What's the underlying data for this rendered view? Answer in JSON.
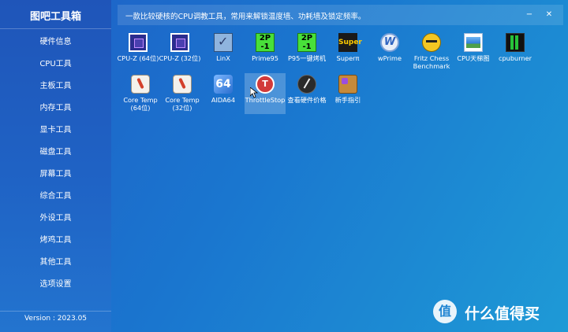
{
  "app": {
    "title": "图吧工具箱",
    "version": "Version : 2023.05"
  },
  "sidebar": {
    "items": [
      {
        "label": "硬件信息"
      },
      {
        "label": "CPU工具"
      },
      {
        "label": "主板工具"
      },
      {
        "label": "内存工具"
      },
      {
        "label": "显卡工具"
      },
      {
        "label": "磁盘工具"
      },
      {
        "label": "屏幕工具"
      },
      {
        "label": "综合工具"
      },
      {
        "label": "外设工具"
      },
      {
        "label": "烤鸡工具"
      },
      {
        "label": "其他工具"
      },
      {
        "label": "选项设置"
      }
    ]
  },
  "notice": {
    "text": "一款比较硬核的CPU调教工具，常用来解锁温度墙、功耗墙及锁定频率。",
    "minimize_icon": "−",
    "close_icon": "✕"
  },
  "tools": [
    {
      "label": "CPU-Z (64位)",
      "icon": "cpuz",
      "text": ""
    },
    {
      "label": "CPU-Z (32位)",
      "icon": "cpuz",
      "text": ""
    },
    {
      "label": "LinX",
      "icon": "linx",
      "text": ""
    },
    {
      "label": "Prime95",
      "icon": "prime",
      "text": "2P\n-1"
    },
    {
      "label": "P95一键烤机",
      "icon": "prime",
      "text": "2P\n-1"
    },
    {
      "label": "Superπ",
      "icon": "superpi",
      "text": "Super"
    },
    {
      "label": "wPrime",
      "icon": "wprime",
      "text": "W"
    },
    {
      "label": "Fritz Chess\nBenchmark",
      "icon": "fritz",
      "text": ""
    },
    {
      "label": "CPU天梯图",
      "icon": "cpusky",
      "text": ""
    },
    {
      "label": "cpuburner",
      "icon": "cpuburner",
      "text": ""
    },
    {
      "label": "Core Temp\n(64位)",
      "icon": "coretemp",
      "text": ""
    },
    {
      "label": "Core Temp\n(32位)",
      "icon": "coretemp",
      "text": ""
    },
    {
      "label": "AIDA64",
      "icon": "aida",
      "text": "64"
    },
    {
      "label": "ThrottleStop",
      "icon": "throttle",
      "text": "T",
      "selected": true
    },
    {
      "label": "查看硬件价格",
      "icon": "checkprice",
      "text": ""
    },
    {
      "label": "新手指引",
      "icon": "guide",
      "text": ""
    }
  ],
  "watermark": {
    "logo_text": "值",
    "text": "什么值得买"
  },
  "colors": {
    "sidebar": "#1f5fc6",
    "background_end": "#1e9ad6",
    "selected_tile": "rgba(255,255,255,0.22)"
  }
}
